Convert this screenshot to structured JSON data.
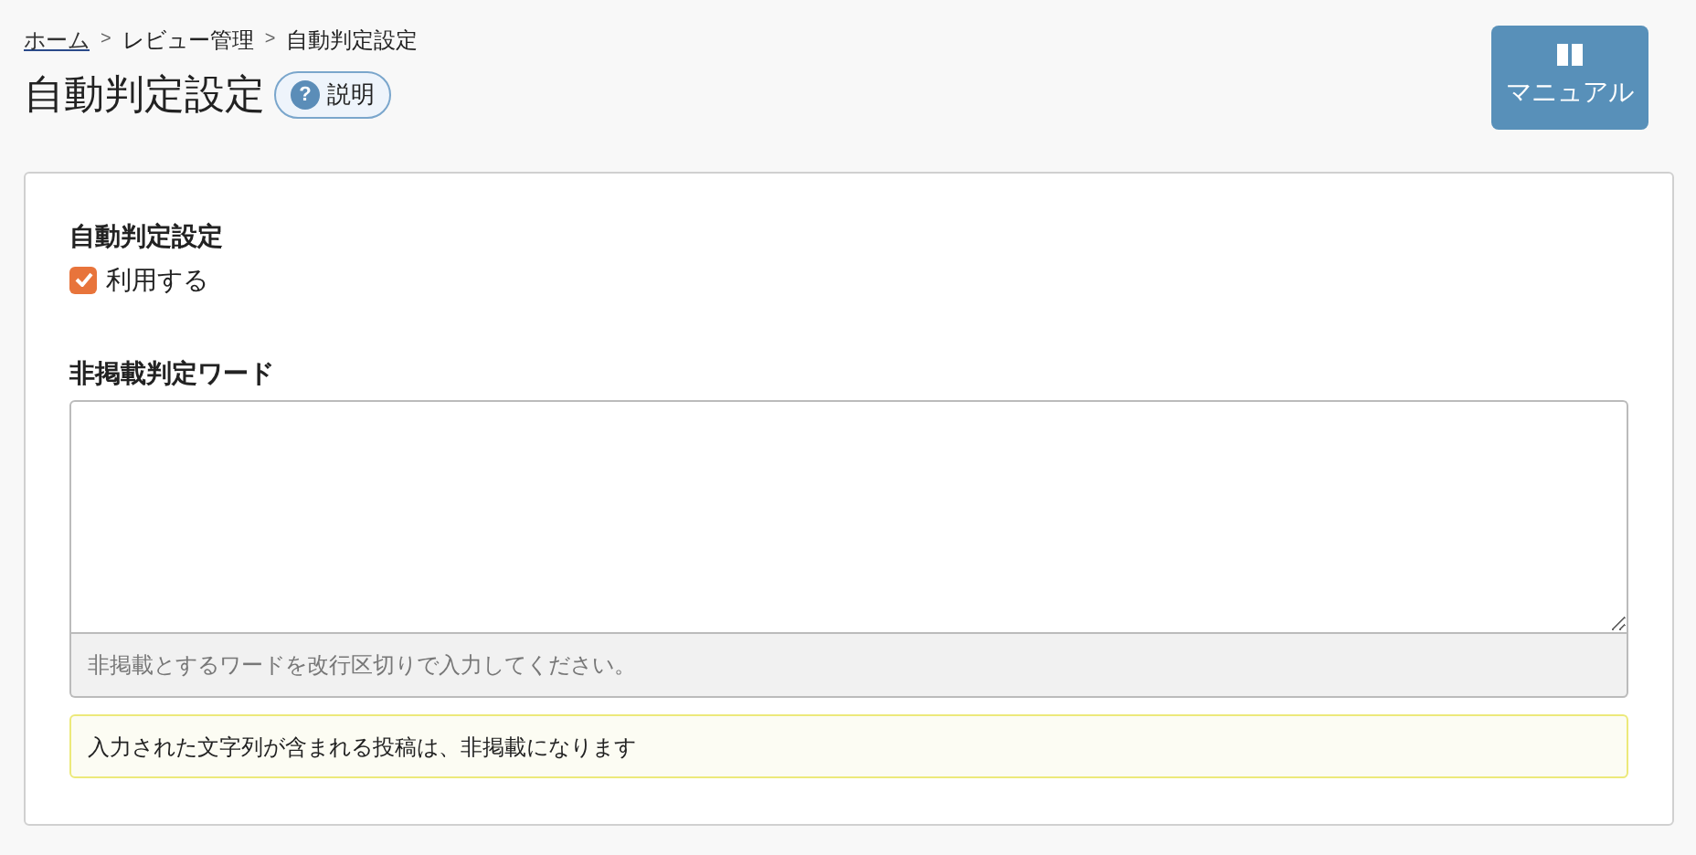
{
  "breadcrumb": [
    {
      "label": "ホーム",
      "kind": "link"
    },
    {
      "label": "レビュー管理",
      "kind": "text"
    },
    {
      "label": "自動判定設定",
      "kind": "text"
    }
  ],
  "breadcrumb_separator": ">",
  "title": "自動判定設定",
  "help_button": {
    "icon": "?",
    "label": "説明"
  },
  "manual_button": {
    "label": "マニュアル"
  },
  "auto_judge": {
    "label": "自動判定設定",
    "checkbox": {
      "label": "利用する",
      "checked": true
    }
  },
  "words": {
    "label": "非掲載判定ワード",
    "help": "非掲載とするワードを改行区切りで入力してください。"
  },
  "note": "入力された文字列が含まれる投稿は、非掲載になります"
}
